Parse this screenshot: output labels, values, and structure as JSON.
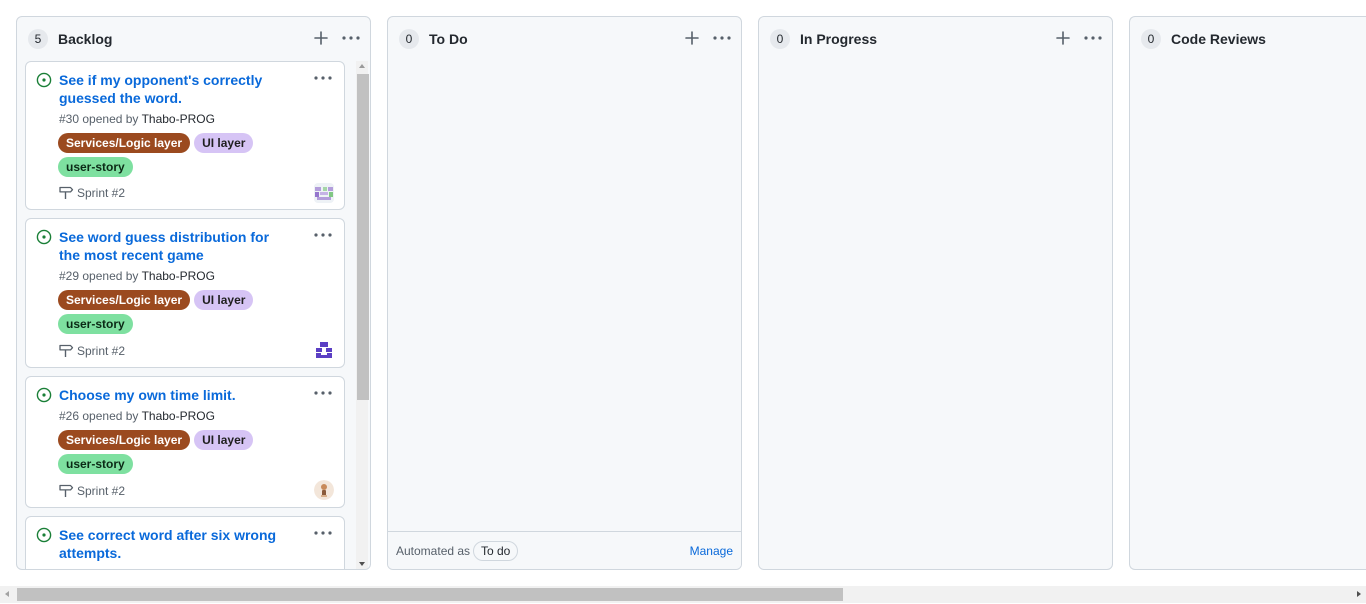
{
  "columns": [
    {
      "count": "5",
      "title": "Backlog",
      "cards": [
        {
          "title": "See if my opponent's correctly guessed the word.",
          "number": "#30",
          "opened_by": "opened by",
          "author": "Thabo-PROG",
          "labels": [
            "Services/Logic layer",
            "UI layer",
            "user-story"
          ],
          "sprint": "Sprint #2",
          "avatar": "pixel-avatar-purple-green"
        },
        {
          "title": "See word guess distribution for the most recent game",
          "number": "#29",
          "opened_by": "opened by",
          "author": "Thabo-PROG",
          "labels": [
            "Services/Logic layer",
            "UI layer",
            "user-story"
          ],
          "sprint": "Sprint #2",
          "avatar": "pixel-avatar-purple"
        },
        {
          "title": "Choose my own time limit.",
          "number": "#26",
          "opened_by": "opened by",
          "author": "Thabo-PROG",
          "labels": [
            "Services/Logic layer",
            "UI layer",
            "user-story"
          ],
          "sprint": "Sprint #2",
          "avatar": "photo-avatar"
        },
        {
          "title": "See correct word after six wrong attempts."
        }
      ]
    },
    {
      "count": "0",
      "title": "To Do",
      "footer": {
        "automated_label": "Automated as",
        "automated_value": "To do",
        "manage": "Manage"
      }
    },
    {
      "count": "0",
      "title": "In Progress"
    },
    {
      "count": "0",
      "title": "Code Reviews"
    }
  ],
  "icons": {
    "add": "plus-icon",
    "more": "kebab-horizontal-icon",
    "issue": "issue-opened-icon",
    "sprint": "milestone-icon"
  },
  "colors": {
    "link": "#0969da",
    "issue_open": "#1a7f37",
    "label_services": "#9b4a1f",
    "label_ui": "#d6c4f5",
    "label_story": "#7ee0a0"
  }
}
